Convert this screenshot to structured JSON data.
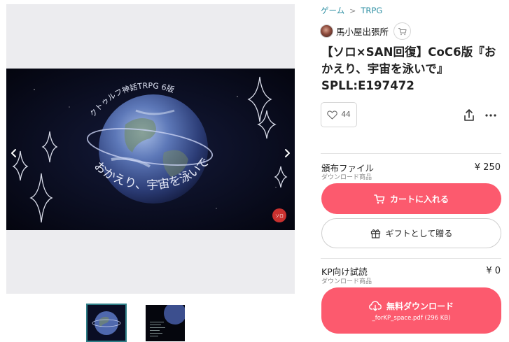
{
  "gallery": {
    "cover_text_arc": "クトゥルフ神話TRPG 6版",
    "cover_text_main": "おかえり、宇宙を泳いで",
    "seal_text": "ソロ",
    "prev_icon": "chevron-left-icon",
    "next_icon": "chevron-right-icon"
  },
  "breadcrumb": {
    "items": [
      "ゲーム",
      "TRPG"
    ]
  },
  "shop": {
    "name": "馬小屋出張所"
  },
  "product": {
    "title": "【ソロ×SAN回復】CoC6版『おかえり、宇宙を泳いで』SPLL:E197472"
  },
  "actions": {
    "like_count": "44"
  },
  "variants": [
    {
      "name": "頒布ファイル",
      "type": "ダウンロード商品",
      "price": "¥ 250",
      "cart_label": "カートに入れる",
      "gift_label": "ギフトとして贈る"
    },
    {
      "name": "KP向け試読",
      "type": "ダウンロード商品",
      "price": "¥ 0",
      "download_label": "無料ダウンロード",
      "file_label": "_forKP_space.pdf (296 KB)"
    }
  ],
  "colors": {
    "accent": "#fc5a6e",
    "link": "#2d8fa3"
  }
}
